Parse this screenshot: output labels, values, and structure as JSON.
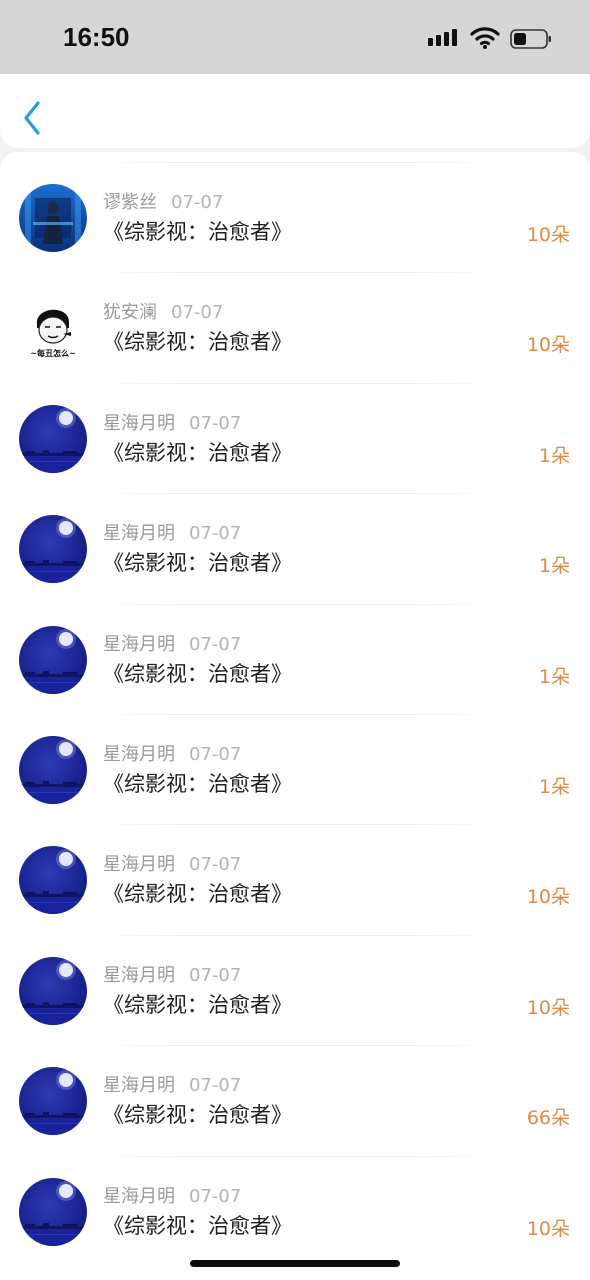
{
  "status_bar": {
    "time": "16:50"
  },
  "nav": {
    "back_icon": "chevron-left-icon"
  },
  "colors": {
    "accent": "#2d9cdb",
    "amount": "#e08b47",
    "moon_avatar": "#1e2a9c"
  },
  "records": [
    {
      "name": "谬紫丝",
      "date": "07-07",
      "title": "《综影视：治愈者》",
      "amount": "10朵",
      "avatar": "blue-figure"
    },
    {
      "name": "犹安澜",
      "date": "07-07",
      "title": "《综影视：治愈者》",
      "amount": "10朵",
      "avatar": "cartoon-meme"
    },
    {
      "name": "星海月明",
      "date": "07-07",
      "title": "《综影视：治愈者》",
      "amount": "1朵",
      "avatar": "moon"
    },
    {
      "name": "星海月明",
      "date": "07-07",
      "title": "《综影视：治愈者》",
      "amount": "1朵",
      "avatar": "moon"
    },
    {
      "name": "星海月明",
      "date": "07-07",
      "title": "《综影视：治愈者》",
      "amount": "1朵",
      "avatar": "moon"
    },
    {
      "name": "星海月明",
      "date": "07-07",
      "title": "《综影视：治愈者》",
      "amount": "1朵",
      "avatar": "moon"
    },
    {
      "name": "星海月明",
      "date": "07-07",
      "title": "《综影视：治愈者》",
      "amount": "10朵",
      "avatar": "moon"
    },
    {
      "name": "星海月明",
      "date": "07-07",
      "title": "《综影视：治愈者》",
      "amount": "10朵",
      "avatar": "moon"
    },
    {
      "name": "星海月明",
      "date": "07-07",
      "title": "《综影视：治愈者》",
      "amount": "66朵",
      "avatar": "moon"
    },
    {
      "name": "星海月明",
      "date": "07-07",
      "title": "《综影视：治愈者》",
      "amount": "10朵",
      "avatar": "moon"
    }
  ],
  "meme_caption": "~每丑怎么~"
}
